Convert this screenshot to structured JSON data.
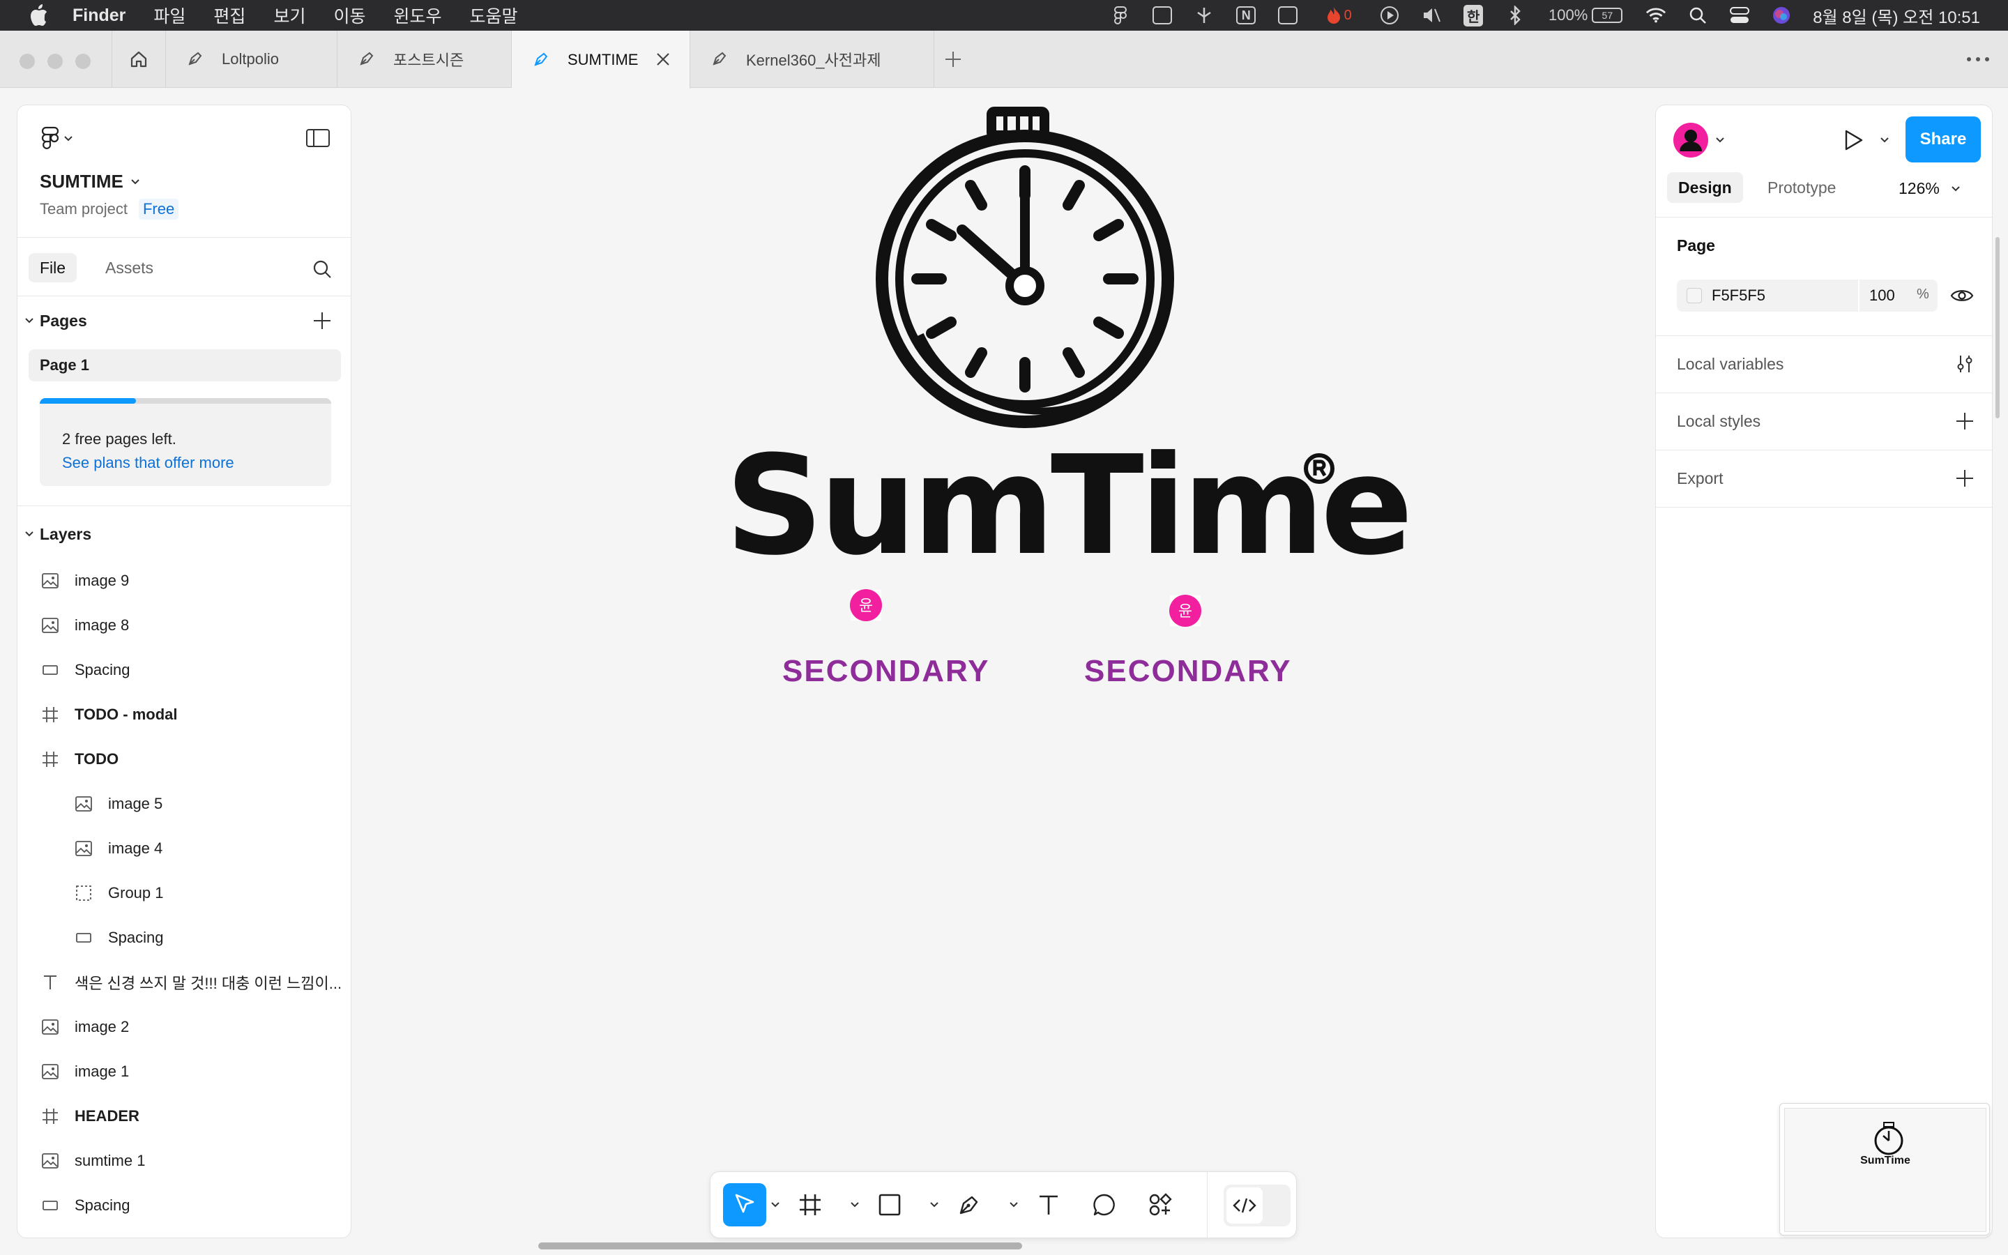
{
  "menubar": {
    "app": "Finder",
    "menus": [
      "파일",
      "편집",
      "보기",
      "이동",
      "윈도우",
      "도움말"
    ],
    "battery": "100%",
    "battery_pill": "57",
    "input_method": "한",
    "red_counter": "0",
    "clock": "8월 8일 (목) 오전 10:51"
  },
  "tabs": [
    {
      "label": "Loltpolio"
    },
    {
      "label": "포스트시즌"
    },
    {
      "label": "SUMTIME"
    },
    {
      "label": "Kernel360_사전과제"
    }
  ],
  "left_panel": {
    "project_name": "SUMTIME",
    "project_type": "Team project",
    "plan_badge": "Free",
    "tab_file": "File",
    "tab_assets": "Assets",
    "pages_title": "Pages",
    "current_page": "Page 1",
    "pages_used_fraction": 0.33,
    "free_pages_text": "2 free pages left.",
    "see_plans_link": "See plans that offer more",
    "layers_title": "Layers",
    "layers": [
      {
        "name": "image 9",
        "type": "image"
      },
      {
        "name": "image 8",
        "type": "image"
      },
      {
        "name": "Spacing",
        "type": "rect"
      },
      {
        "name": "TODO - modal",
        "type": "frame"
      },
      {
        "name": "TODO",
        "type": "frame"
      },
      {
        "name": "image 5",
        "type": "image",
        "child": true
      },
      {
        "name": "image 4",
        "type": "image",
        "child": true
      },
      {
        "name": "Group 1",
        "type": "group",
        "child": true
      },
      {
        "name": "Spacing",
        "type": "rect",
        "child": true
      },
      {
        "name": "색은 신경 쓰지 말 것!!! 대충 이런 느낌이...",
        "type": "text"
      },
      {
        "name": "image 2",
        "type": "image"
      },
      {
        "name": "image 1",
        "type": "image"
      },
      {
        "name": "HEADER",
        "type": "frame"
      },
      {
        "name": "sumtime 1",
        "type": "image"
      },
      {
        "name": "Spacing",
        "type": "rect"
      }
    ]
  },
  "canvas": {
    "logo_text": "SumTime",
    "secondary_labels": [
      "SECONDARY",
      "SECONDARY"
    ],
    "collaborator_initial": "윤",
    "collaborator_color": "#f21f9e",
    "secondary_color": "#8e2c9a"
  },
  "right_panel": {
    "share_label": "Share",
    "tab_design": "Design",
    "tab_prototype": "Prototype",
    "zoom": "126%",
    "page_section": "Page",
    "page_color_hex": "F5F5F5",
    "page_opacity": "100",
    "opacity_unit": "%",
    "local_variables": "Local variables",
    "local_styles": "Local styles",
    "export": "Export"
  },
  "colors": {
    "accent": "#0d99ff",
    "link": "#0d71d8"
  }
}
